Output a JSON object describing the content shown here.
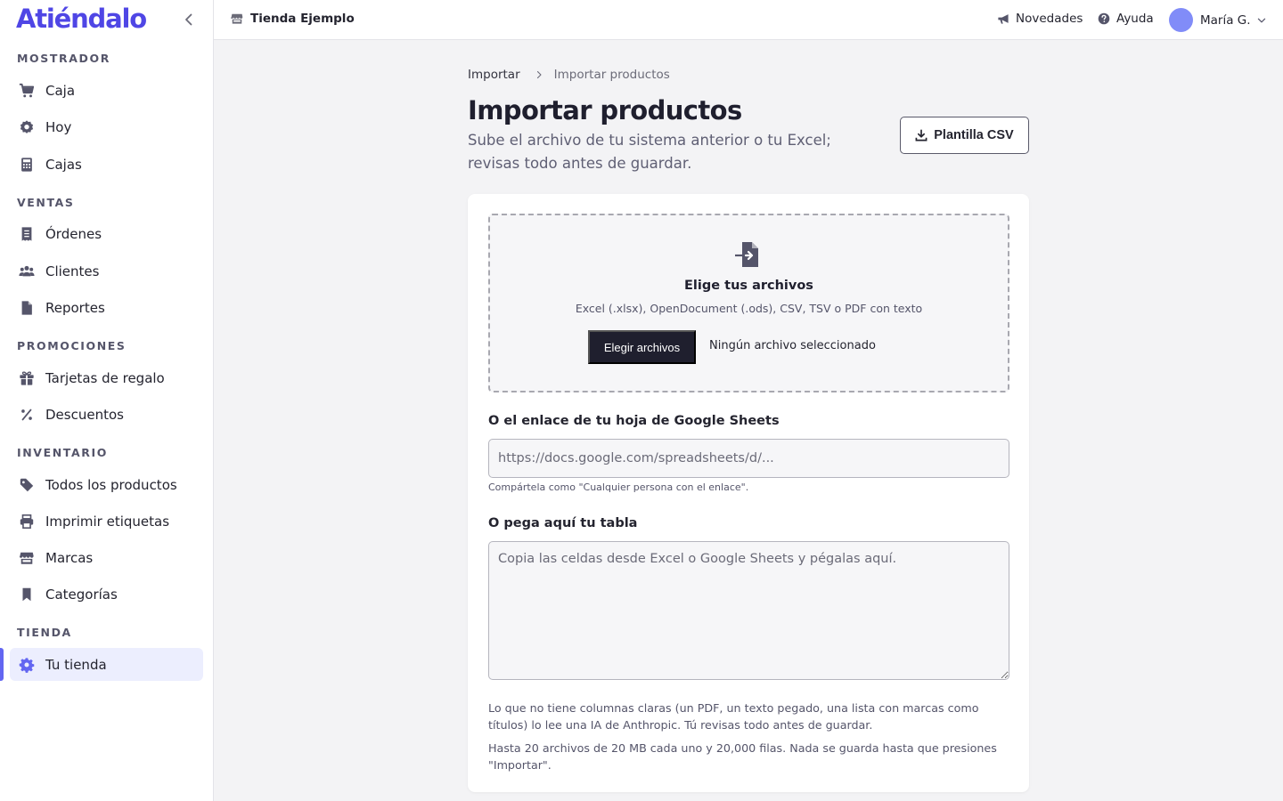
{
  "brand": "Atiéndalo",
  "sidebar": {
    "sections": [
      {
        "title": "MOSTRADOR",
        "items": [
          {
            "label": "Caja",
            "icon": "cart-icon"
          },
          {
            "label": "Hoy",
            "icon": "gear-badge-icon"
          },
          {
            "label": "Cajas",
            "icon": "calculator-icon"
          }
        ]
      },
      {
        "title": "VENTAS",
        "items": [
          {
            "label": "Órdenes",
            "icon": "receipt-icon"
          },
          {
            "label": "Clientes",
            "icon": "users-icon"
          },
          {
            "label": "Reportes",
            "icon": "document-icon"
          }
        ]
      },
      {
        "title": "PROMOCIONES",
        "items": [
          {
            "label": "Tarjetas de regalo",
            "icon": "gift-icon"
          },
          {
            "label": "Descuentos",
            "icon": "percent-icon"
          }
        ]
      },
      {
        "title": "INVENTARIO",
        "items": [
          {
            "label": "Todos los productos",
            "icon": "tag-icon"
          },
          {
            "label": "Imprimir etiquetas",
            "icon": "printer-icon"
          },
          {
            "label": "Marcas",
            "icon": "store-icon"
          },
          {
            "label": "Categorías",
            "icon": "bookmark-icon"
          }
        ]
      },
      {
        "title": "TIENDA",
        "items": [
          {
            "label": "Tu tienda",
            "icon": "settings-icon",
            "active": true
          }
        ]
      }
    ]
  },
  "topbar": {
    "store_name": "Tienda Ejemplo",
    "news_label": "Novedades",
    "help_label": "Ayuda",
    "user_name": "María G."
  },
  "breadcrumb": {
    "parent": "Importar",
    "current": "Importar productos"
  },
  "page": {
    "title": "Importar productos",
    "subtitle": "Sube el archivo de tu sistema anterior o tu Excel; revisas todo antes de guardar.",
    "template_button": "Plantilla CSV"
  },
  "upload": {
    "title": "Elige tus archivos",
    "formats": "Excel (.xlsx), OpenDocument (.ods), CSV, TSV o PDF con texto",
    "button": "Elegir archivos",
    "status": "Ningún archivo seleccionado"
  },
  "sheets": {
    "label": "O el enlace de tu hoja de Google Sheets",
    "placeholder": "https://docs.google.com/spreadsheets/d/...",
    "value": "",
    "hint": "Compártela como \"Cualquier persona con el enlace\"."
  },
  "paste": {
    "label": "O pega aquí tu tabla",
    "placeholder": "Copia las celdas desde Excel o Google Sheets y pégalas aquí.",
    "value": ""
  },
  "notes": {
    "ai": "Lo que no tiene columnas claras (un PDF, un texto pegado, una lista con marcas como títulos) lo lee una IA de Anthropic. Tú revisas todo antes de guardar.",
    "limits": "Hasta 20 archivos de 20 MB cada uno y 20,000 filas. Nada se guarda hasta que presiones \"Importar\"."
  },
  "colors": {
    "accent": "#6366f1",
    "brand": "#4f46e5",
    "active_bg": "#eceefe",
    "dark_button": "#1f1f2e",
    "avatar": "#818cf8"
  }
}
